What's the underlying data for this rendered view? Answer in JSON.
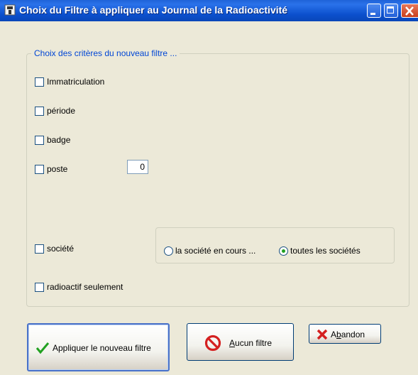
{
  "window": {
    "title": "Choix du Filtre à appliquer au Journal de la Radioactivité"
  },
  "group": {
    "legend": "Choix des critères du nouveau filtre ..."
  },
  "criteria": [
    {
      "label": "Immatriculation",
      "checked": false
    },
    {
      "label": "période",
      "checked": false
    },
    {
      "label": "badge",
      "checked": false
    },
    {
      "label": "poste",
      "checked": false
    },
    {
      "label": "société",
      "checked": false
    },
    {
      "label": "radioactif seulement",
      "checked": false
    }
  ],
  "poste_value": "0",
  "societe_options": [
    {
      "label": "la société en cours ...",
      "selected": false
    },
    {
      "label": "toutes les sociétés",
      "selected": true
    }
  ],
  "buttons": {
    "apply": "Appliquer le nouveau filtre",
    "none_underlined": "A",
    "none_rest": "ucun filtre",
    "abort_first": "A",
    "abort_underlined": "b",
    "abort_rest": "andon"
  },
  "colors": {
    "titlebar": "#0b4fcc",
    "legend": "#0046d5",
    "check_icon": "#21a121",
    "cross_icon": "#d42020"
  }
}
